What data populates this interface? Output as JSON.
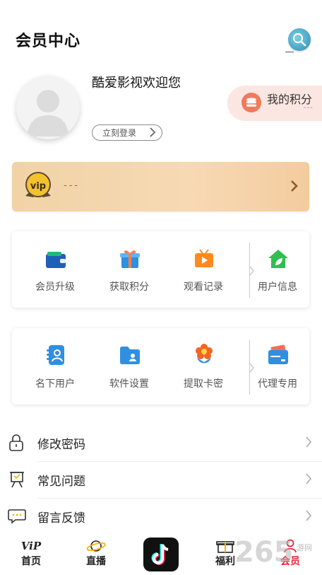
{
  "header": {
    "title": "会员中心",
    "search_icon": "search-icon"
  },
  "profile": {
    "welcome": "酷爱影视欢迎您",
    "login_button": "立刻登录",
    "points_label": "我的积分",
    "points_value": "---"
  },
  "vip": {
    "badge": "vip",
    "value": "---"
  },
  "grid1": [
    {
      "label": "会员升级",
      "icon": "wallet-icon",
      "color": "#1f5fb8"
    },
    {
      "label": "获取积分",
      "icon": "gift-icon",
      "color": "#2f8fe0"
    },
    {
      "label": "观看记录",
      "icon": "tv-play-icon",
      "color": "#ff8a1e"
    },
    {
      "label": "用户信息",
      "icon": "home-leaf-icon",
      "color": "#2fbf4f"
    }
  ],
  "grid2": [
    {
      "label": "名下用户",
      "icon": "contact-book-icon",
      "color": "#2f8fe0"
    },
    {
      "label": "软件设置",
      "icon": "folder-user-icon",
      "color": "#2f8fe0"
    },
    {
      "label": "提取卡密",
      "icon": "flower-icon",
      "color": "#f26522"
    },
    {
      "label": "代理专用",
      "icon": "card-wallet-icon",
      "color": "#2f8fe0"
    }
  ],
  "menu": [
    {
      "label": "修改密码",
      "icon": "lock-icon"
    },
    {
      "label": "常见问题",
      "icon": "easel-icon"
    },
    {
      "label": "留言反馈",
      "icon": "chat-icon"
    }
  ],
  "tabs": [
    {
      "label": "首页",
      "icon": "vip-text-icon"
    },
    {
      "label": "直播",
      "icon": "planet-icon"
    },
    {
      "label": "福利",
      "icon": "gift-box-icon"
    },
    {
      "label": "会员",
      "icon": "user-icon",
      "active": true
    }
  ],
  "watermark": {
    "text": "265",
    "small": "游网"
  },
  "colors": {
    "active_tab": "#e8263b",
    "vip_bar": "#f5d6ad",
    "points_bg": "#fbe6e2"
  }
}
